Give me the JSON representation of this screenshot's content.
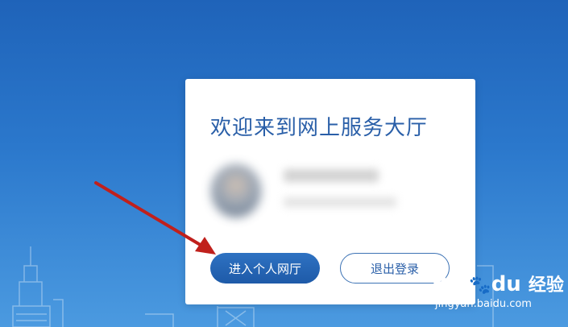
{
  "panel": {
    "title": "欢迎来到网上服务大厅"
  },
  "buttons": {
    "enter_label": "进入个人网厅",
    "logout_label": "退出登录"
  },
  "watermark": {
    "brand_text": "Bai",
    "brand_suffix": "du",
    "product": "经验",
    "url": "jingyan.baidu.com"
  },
  "colors": {
    "background_top": "#1f63b9",
    "background_bottom": "#4b9ae0",
    "title": "#2a5fa8",
    "primary_button": "#1e5aa8",
    "annotation_arrow": "#c0201c"
  },
  "icons": {
    "avatar": "user-avatar-blurred",
    "arrow": "red-annotation-arrow",
    "watermark_logo": "baidu-paw-icon"
  }
}
